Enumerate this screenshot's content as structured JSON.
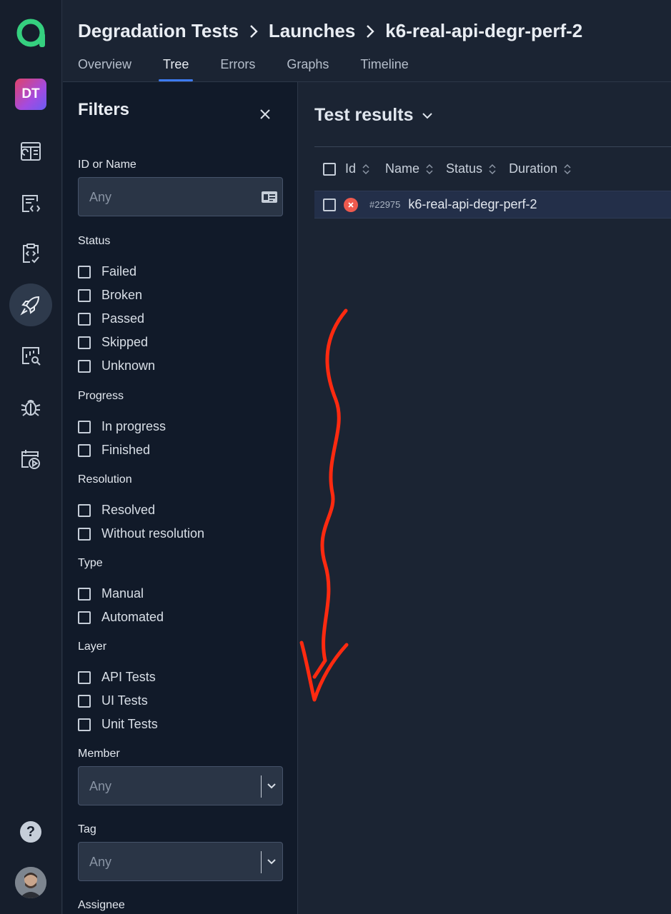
{
  "sidebar": {
    "project_initials": "DT",
    "items": [
      {
        "name": "dashboards-icon"
      },
      {
        "name": "test-cases-icon"
      },
      {
        "name": "test-plans-icon"
      },
      {
        "name": "launches-icon",
        "active": true
      },
      {
        "name": "analytics-icon"
      },
      {
        "name": "defects-icon"
      },
      {
        "name": "jobs-icon"
      }
    ],
    "help_label": "?"
  },
  "header": {
    "breadcrumbs": [
      "Degradation Tests",
      "Launches",
      "k6-real-api-degr-perf-2"
    ],
    "tabs": [
      {
        "label": "Overview",
        "active": false
      },
      {
        "label": "Tree",
        "active": true
      },
      {
        "label": "Errors",
        "active": false
      },
      {
        "label": "Graphs",
        "active": false
      },
      {
        "label": "Timeline",
        "active": false
      }
    ]
  },
  "filters": {
    "title": "Filters",
    "id_or_name": {
      "label": "ID or Name",
      "placeholder": "Any"
    },
    "status": {
      "label": "Status",
      "options": [
        "Failed",
        "Broken",
        "Passed",
        "Skipped",
        "Unknown"
      ]
    },
    "progress": {
      "label": "Progress",
      "options": [
        "In progress",
        "Finished"
      ]
    },
    "resolution": {
      "label": "Resolution",
      "options": [
        "Resolved",
        "Without resolution"
      ]
    },
    "type": {
      "label": "Type",
      "options": [
        "Manual",
        "Automated"
      ]
    },
    "layer": {
      "label": "Layer",
      "options": [
        "API Tests",
        "UI Tests",
        "Unit Tests"
      ]
    },
    "member": {
      "label": "Member",
      "placeholder": "Any"
    },
    "tag": {
      "label": "Tag",
      "placeholder": "Any"
    },
    "assignee": {
      "label": "Assignee"
    }
  },
  "main": {
    "title": "Test results",
    "columns": [
      "Id",
      "Name",
      "Status",
      "Duration"
    ],
    "rows": [
      {
        "id": "#22975",
        "name": "k6-real-api-degr-perf-2",
        "status": "failed"
      }
    ]
  },
  "colors": {
    "accent": "#3d7bf2",
    "failed": "#ef5a4e",
    "annotation": "#ff2a10",
    "logo": "#35d07f"
  }
}
